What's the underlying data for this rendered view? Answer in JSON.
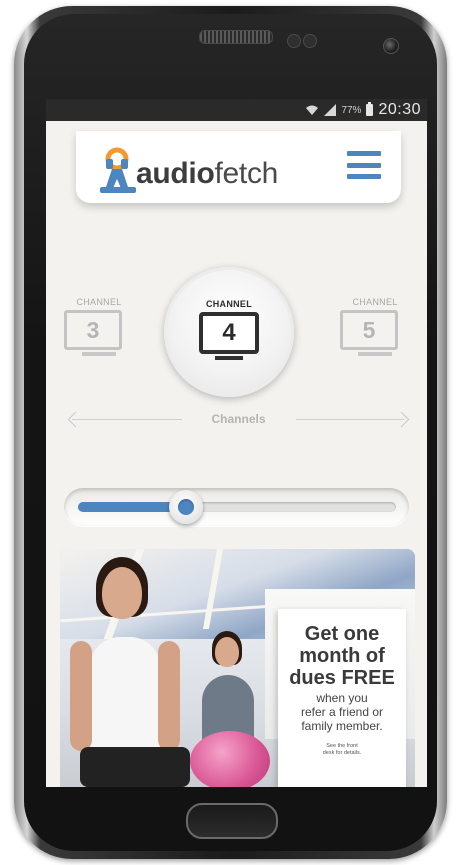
{
  "status_bar": {
    "battery_percent": "77%",
    "time": "20:30",
    "icons": [
      "wifi-icon",
      "signal-icon",
      "battery-icon"
    ]
  },
  "app": {
    "logo": {
      "text_bold": "audio",
      "text_regular": "fetch"
    },
    "menu_icon": "hamburger-menu-icon",
    "accent_color": "#4d86bf"
  },
  "channels": {
    "prev": {
      "label": "CHANNEL",
      "number": "3"
    },
    "current": {
      "label": "CHANNEL",
      "number": "4"
    },
    "next": {
      "label": "CHANNEL",
      "number": "5"
    },
    "caption": "Channels"
  },
  "volume": {
    "level": 0.34
  },
  "ad": {
    "headline": [
      "Get one",
      "month of",
      "dues FREE"
    ],
    "body": [
      "when you",
      "refer a friend or",
      "family member."
    ],
    "fine_print": [
      "See the front",
      "desk for details."
    ]
  }
}
